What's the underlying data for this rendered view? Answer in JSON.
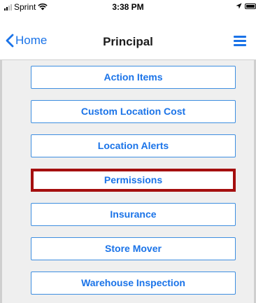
{
  "status_bar": {
    "carrier": "Sprint",
    "time": "3:38 PM"
  },
  "nav": {
    "back_label": "Home",
    "title": "Principal"
  },
  "menu": {
    "items": [
      {
        "label": "Action Items"
      },
      {
        "label": "Custom Location Cost"
      },
      {
        "label": "Location Alerts"
      },
      {
        "label": "Permissions",
        "highlighted": true
      },
      {
        "label": "Insurance"
      },
      {
        "label": "Store Mover"
      },
      {
        "label": "Warehouse Inspection"
      }
    ]
  },
  "colors": {
    "accent": "#1a73e8",
    "highlight_border": "#a50f0f",
    "background": "#efefef"
  }
}
